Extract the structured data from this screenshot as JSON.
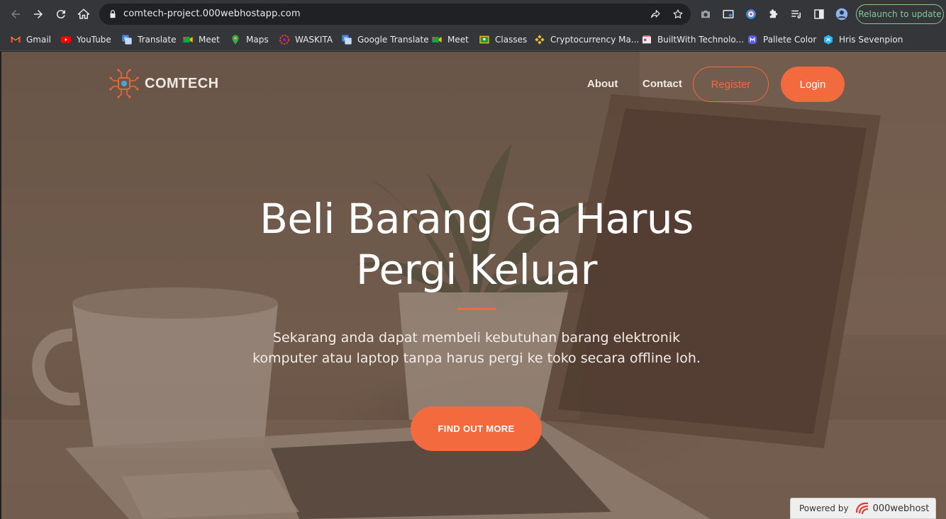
{
  "browser": {
    "url": "comtech-project.000webhostapp.com",
    "relaunch_label": "Relaunch to update",
    "bookmarks": [
      {
        "label": "Gmail",
        "icon": "gmail-icon"
      },
      {
        "label": "YouTube",
        "icon": "youtube-icon"
      },
      {
        "label": "Translate",
        "icon": "translate-icon"
      },
      {
        "label": "Meet",
        "icon": "meet-icon"
      },
      {
        "label": "Maps",
        "icon": "maps-icon"
      },
      {
        "label": "WASKITA",
        "icon": "waskita-icon"
      },
      {
        "label": "Google Translate",
        "icon": "translate-icon"
      },
      {
        "label": "Meet",
        "icon": "meet-icon"
      },
      {
        "label": "Classes",
        "icon": "classroom-icon"
      },
      {
        "label": "Cryptocurrency Ma...",
        "icon": "binance-icon"
      },
      {
        "label": "BuiltWith Technolo...",
        "icon": "builtwith-icon"
      },
      {
        "label": "Pallete Color",
        "icon": "mastodon-icon"
      },
      {
        "label": "Hris Sevenpion",
        "icon": "hris-icon"
      }
    ]
  },
  "site": {
    "brand": "COMTECH",
    "nav": {
      "about": "About",
      "contact": "Contact",
      "register": "Register",
      "login": "Login"
    },
    "hero": {
      "title_line1": "Beli Barang Ga Harus",
      "title_line2": "Pergi Keluar",
      "subtitle_line1": "Sekarang anda dapat membeli kebutuhan barang elektronik",
      "subtitle_line2": "komputer atau laptop tanpa harus pergi ke toko secara offline loh.",
      "cta": "FIND OUT MORE"
    },
    "powered_by": {
      "label": "Powered by",
      "brand": "000webhost"
    }
  },
  "colors": {
    "accent": "#f26a3d",
    "chrome_bg": "#35363a",
    "omnibox_bg": "#202124",
    "relaunch": "#81c995"
  }
}
